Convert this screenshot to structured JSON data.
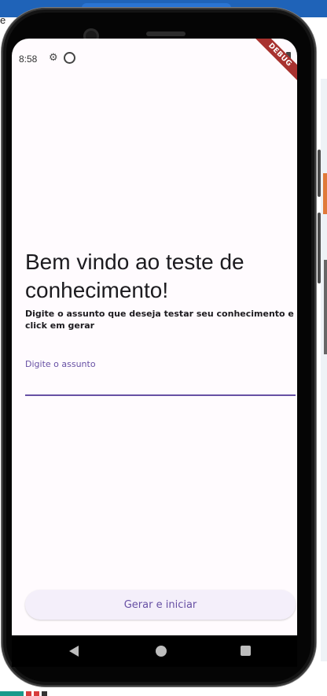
{
  "status_bar": {
    "time": "8:58"
  },
  "debug_banner": {
    "text": "DEBUG"
  },
  "main": {
    "title": "Bem vindo ao teste de conhecimento!",
    "subtitle": "Digite o assunto que deseja testar seu conhecimento e click em gerar",
    "field_label": "Digite o assunto",
    "field_value": "",
    "button_label": "Gerar e iniciar"
  },
  "colors": {
    "accent": "#6750a4",
    "screen_background": "#fffbfe",
    "button_background": "#f4effa",
    "debug_banner": "#a8322f"
  },
  "icons": [
    "settings-icon",
    "sync-icon",
    "wifi-icon",
    "battery-icon",
    "back-icon",
    "home-icon",
    "recents-icon"
  ]
}
